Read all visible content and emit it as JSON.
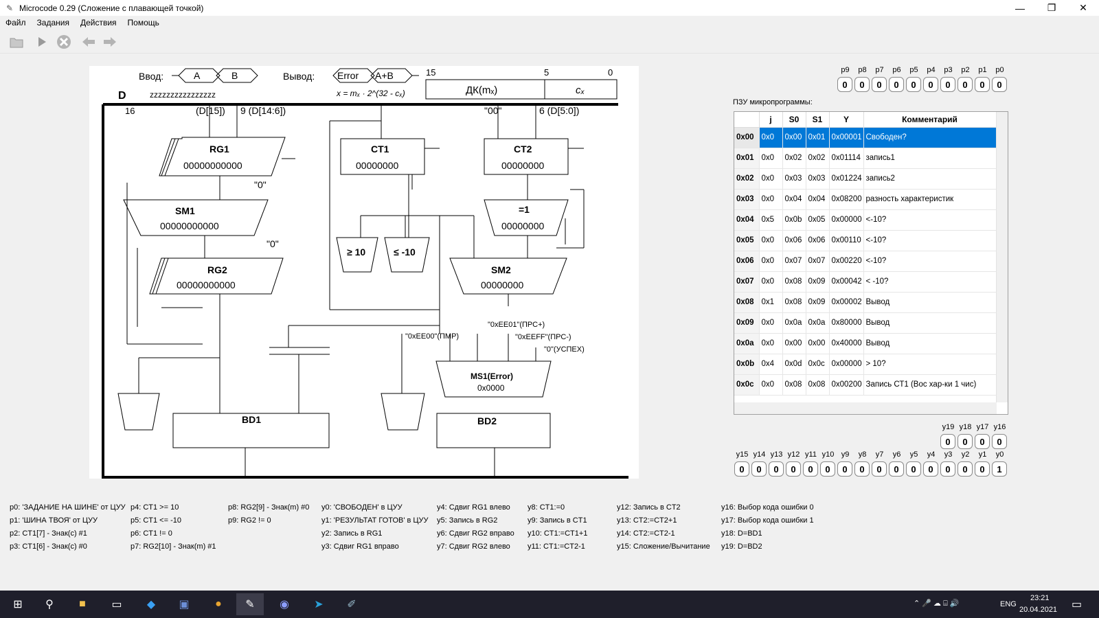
{
  "window": {
    "title": "Microcode 0.29 (Сложение с плавающей точкой)"
  },
  "menu": [
    "Файл",
    "Задания",
    "Действия",
    "Помощь"
  ],
  "schematic": {
    "input_label": "Ввод:",
    "input_a": "A",
    "input_b": "B",
    "output_label": "Вывод:",
    "output_error": "Error",
    "output_sum": "A+B",
    "formula": "x = mₓ · 2^(32 - cₓ)",
    "dk_label": "ДК(mₓ)",
    "cx_label": "cₓ",
    "dk_bits": [
      "15",
      "5",
      "0"
    ],
    "bus_label": "D",
    "bus_value": "zzzzzzzzzzzzzzzz",
    "bus_width": "16",
    "rg1": {
      "name": "RG1",
      "value": "00000000000"
    },
    "sm1": {
      "name": "SM1",
      "value": "00000000000"
    },
    "rg2": {
      "name": "RG2",
      "value": "00000000000"
    },
    "ct1": {
      "name": "CT1",
      "value": "00000000"
    },
    "ct2": {
      "name": "CT2",
      "value": "00000000"
    },
    "eq1": {
      "name": "=1",
      "value": "00000000"
    },
    "sm2": {
      "name": "SM2",
      "value": "00000000"
    },
    "ms1": {
      "name": "MS1(Error)",
      "value": "0x0000"
    },
    "bd1": {
      "name": "BD1"
    },
    "bd2": {
      "name": "BD2"
    },
    "ge10": "≥ 10",
    "le_m10": "≤ -10",
    "const_pmr": "\"0xEE00\"(ПМР)",
    "const_prs_plus": "\"0xEE01\"(ПРС+)",
    "const_prs_minus": "\"0xEEFF\"(ПРС-)",
    "const_success": "\"0\"(УСПЕХ)",
    "const_00": "\"00\"",
    "label_d15": "(D[15])",
    "label_d14_6": "9 (D[14:6])",
    "label_d5_0": "6 (D[5:0])",
    "label_zero": "\"0\""
  },
  "p_flags": {
    "labels": [
      "p9",
      "p8",
      "p7",
      "p6",
      "p5",
      "p4",
      "p3",
      "p2",
      "p1",
      "p0"
    ],
    "values": [
      "0",
      "0",
      "0",
      "0",
      "0",
      "0",
      "0",
      "0",
      "0",
      "0"
    ]
  },
  "rom": {
    "caption": "ПЗУ микропрограммы:",
    "columns": [
      "j",
      "S0",
      "S1",
      "Y",
      "Комментарий"
    ],
    "rows": [
      {
        "addr": "0x00",
        "j": "0x0",
        "s0": "0x00",
        "s1": "0x01",
        "y": "0x00001",
        "comment": "Свободен?"
      },
      {
        "addr": "0x01",
        "j": "0x0",
        "s0": "0x02",
        "s1": "0x02",
        "y": "0x01114",
        "comment": "запись1"
      },
      {
        "addr": "0x02",
        "j": "0x0",
        "s0": "0x03",
        "s1": "0x03",
        "y": "0x01224",
        "comment": "запись2"
      },
      {
        "addr": "0x03",
        "j": "0x0",
        "s0": "0x04",
        "s1": "0x04",
        "y": "0x08200",
        "comment": "разность характеристик"
      },
      {
        "addr": "0x04",
        "j": "0x5",
        "s0": "0x0b",
        "s1": "0x05",
        "y": "0x00000",
        "comment": "<-10?"
      },
      {
        "addr": "0x05",
        "j": "0x0",
        "s0": "0x06",
        "s1": "0x06",
        "y": "0x00110",
        "comment": "<-10?"
      },
      {
        "addr": "0x06",
        "j": "0x0",
        "s0": "0x07",
        "s1": "0x07",
        "y": "0x00220",
        "comment": "<-10?"
      },
      {
        "addr": "0x07",
        "j": "0x0",
        "s0": "0x08",
        "s1": "0x09",
        "y": "0x00042",
        "comment": "< -10?"
      },
      {
        "addr": "0x08",
        "j": "0x1",
        "s0": "0x08",
        "s1": "0x09",
        "y": "0x00002",
        "comment": "Вывод"
      },
      {
        "addr": "0x09",
        "j": "0x0",
        "s0": "0x0a",
        "s1": "0x0a",
        "y": "0x80000",
        "comment": "Вывод"
      },
      {
        "addr": "0x0a",
        "j": "0x0",
        "s0": "0x00",
        "s1": "0x00",
        "y": "0x40000",
        "comment": "Вывод"
      },
      {
        "addr": "0x0b",
        "j": "0x4",
        "s0": "0x0d",
        "s1": "0x0c",
        "y": "0x00000",
        "comment": "> 10?"
      },
      {
        "addr": "0x0c",
        "j": "0x0",
        "s0": "0x08",
        "s1": "0x08",
        "y": "0x00200",
        "comment": "Запись СТ1 (Вос хар-ки 1 чис)"
      }
    ]
  },
  "y_flags_top": {
    "labels": [
      "y19",
      "y18",
      "y17",
      "y16"
    ],
    "values": [
      "0",
      "0",
      "0",
      "0"
    ]
  },
  "y_flags_bottom": {
    "labels": [
      "y15",
      "y14",
      "y13",
      "y12",
      "y11",
      "y10",
      "y9",
      "y8",
      "y7",
      "y6",
      "y5",
      "y4",
      "y3",
      "y2",
      "y1",
      "y0"
    ],
    "values": [
      "0",
      "0",
      "0",
      "0",
      "0",
      "0",
      "0",
      "0",
      "0",
      "0",
      "0",
      "0",
      "0",
      "0",
      "0",
      "1"
    ]
  },
  "legend": [
    "p0: 'ЗАДАНИЕ НА ШИНЕ' от ЦУУ",
    "p1: 'ШИНА ТВОЯ' от ЦУУ",
    "p2: CT1[7] - Знак(c) #1",
    "p3: CT1[6] - Знак(c) #0",
    "p4: CT1 >= 10",
    "p5: CT1 <= -10",
    "p6: CT1 != 0",
    "p7: RG2[10] - Знак(m) #1",
    "p8: RG2[9] - Знак(m) #0",
    "p9: RG2 != 0",
    "y0: 'СВОБОДЕН' в ЦУУ",
    "y1: 'РЕЗУЛЬТАТ ГОТОВ' в ЦУУ",
    "y2: Запись в RG1",
    "y3: Сдвиг RG1 вправо",
    "y4: Сдвиг RG1 влево",
    "y5: Запись в RG2",
    "y6: Сдвиг RG2 вправо",
    "y7: Сдвиг RG2 влево",
    "y8: CT1:=0",
    "y9: Запись в CT1",
    "y10: CT1:=CT1+1",
    "y11: CT1:=CT2-1",
    "y12: Запись в CT2",
    "y13: CT2:=CT2+1",
    "y14: CT2:=CT2-1",
    "y15: Сложение/Вычитание",
    "y16: Выбор кода ошибки 0",
    "y17: Выбор кода ошибки 1",
    "y18: D=BD1",
    "y19: D=BD2"
  ],
  "taskbar": {
    "lang": "ENG",
    "time": "23:21",
    "date": "20.04.2021"
  }
}
